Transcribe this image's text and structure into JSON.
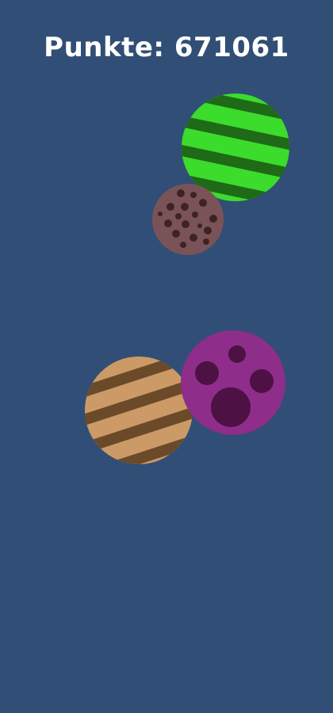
{
  "score": {
    "label": "Punkte:",
    "value": "671061"
  },
  "colors": {
    "background": "#314e76",
    "score_text": "#ffffff"
  },
  "balls": [
    {
      "id": "ball-green",
      "pattern": "stripes",
      "base_color": "#3bdc2c",
      "pattern_color": "#1f6a17"
    },
    {
      "id": "ball-brown",
      "pattern": "dots",
      "base_color": "#7a5359",
      "pattern_color": "#3e2325"
    },
    {
      "id": "ball-tan",
      "pattern": "stripes",
      "base_color": "#cc9a66",
      "pattern_color": "#6b4a2a"
    },
    {
      "id": "ball-purple",
      "pattern": "spots",
      "base_color": "#8e2d8a",
      "pattern_color": "#4d1144"
    }
  ]
}
